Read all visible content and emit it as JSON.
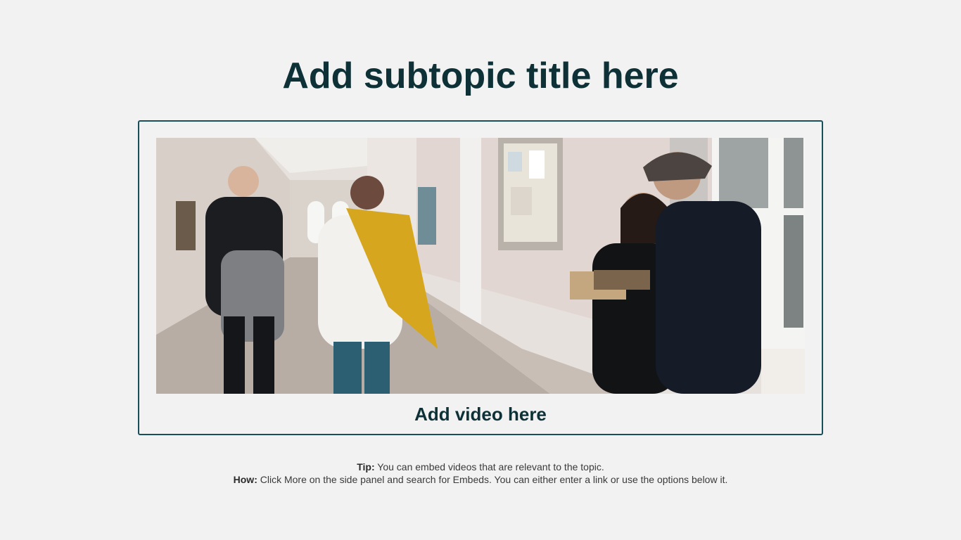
{
  "slide": {
    "title": "Add subtopic title here",
    "video_placeholder": {
      "caption": "Add video here",
      "image_description_icon": "photo-placeholder"
    },
    "tip": {
      "label": "Tip:",
      "text": " You can embed videos that are relevant to the topic."
    },
    "how": {
      "label": "How:",
      "text": " Click More on the side panel and search for Embeds. You can either enter a link or use the options below it."
    }
  },
  "colors": {
    "background": "#f2f2f2",
    "title": "#0d3136",
    "frame_border": "#174f5a",
    "body_text": "#3a3a3a"
  }
}
